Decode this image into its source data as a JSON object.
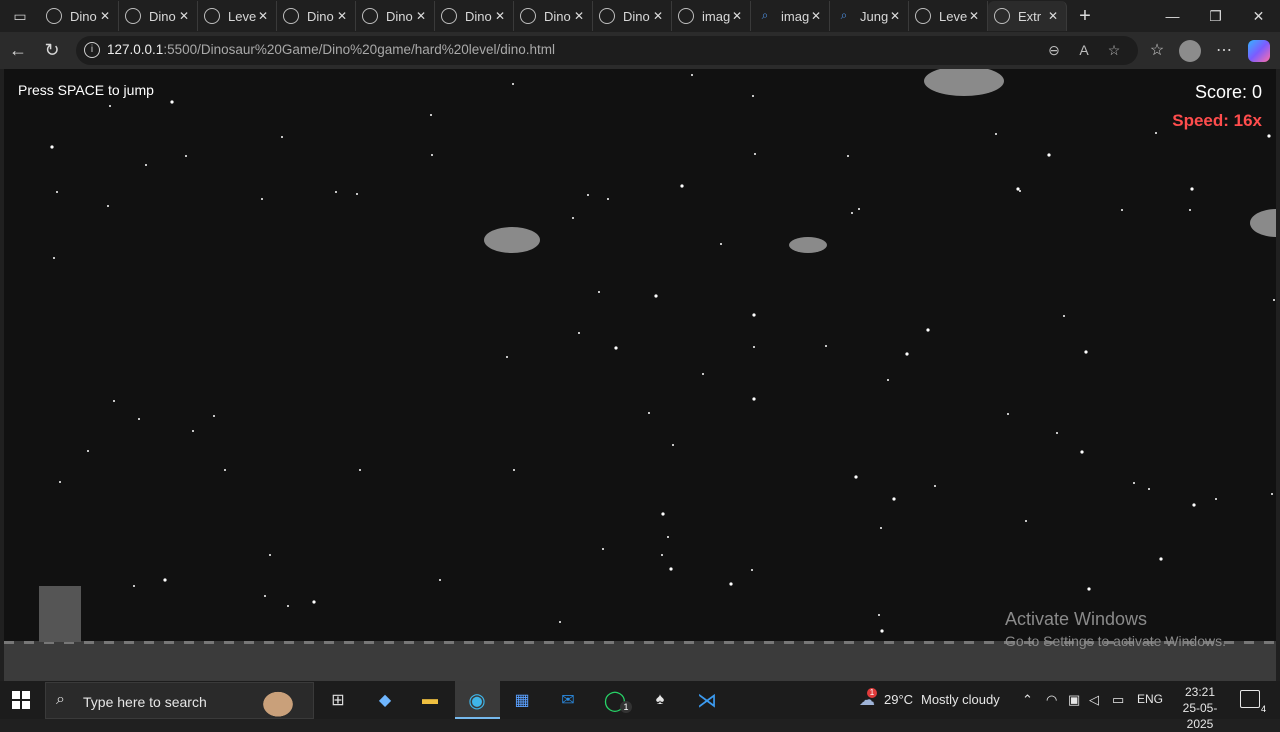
{
  "browser": {
    "tabs": [
      {
        "title": "Dino",
        "icon": "globe-icon"
      },
      {
        "title": "Dino",
        "icon": "globe-icon"
      },
      {
        "title": "Leve",
        "icon": "globe-icon"
      },
      {
        "title": "Dino",
        "icon": "globe-icon"
      },
      {
        "title": "Dino",
        "icon": "globe-icon"
      },
      {
        "title": "Dino",
        "icon": "globe-icon"
      },
      {
        "title": "Dino",
        "icon": "globe-icon"
      },
      {
        "title": "Dino",
        "icon": "globe-icon"
      },
      {
        "title": "imag",
        "icon": "image-search-icon"
      },
      {
        "title": "imag",
        "icon": "search-icon"
      },
      {
        "title": "Jung",
        "icon": "search-icon"
      },
      {
        "title": "Leve",
        "icon": "globe-icon"
      },
      {
        "title": "Extr",
        "icon": "globe-icon",
        "active": true
      }
    ],
    "url_host": "127.0.0.1",
    "url_rest": ":5500/Dinosaur%20Game/Dino%20game/hard%20level/dino.html"
  },
  "game": {
    "hint": "Press SPACE to jump",
    "score_label": "Score: 0",
    "speed_label": "Speed: 16x",
    "score": 0,
    "speed": 16,
    "background_color": "#111111",
    "speed_color": "#ff4d4d"
  },
  "watermark": {
    "line1": "Activate Windows",
    "line2": "Go to Settings to activate Windows."
  },
  "taskbar": {
    "search_placeholder": "Type here to search",
    "weather_temp": "29°C",
    "weather_text": "Mostly cloudy",
    "weather_badge": "1",
    "language": "ENG",
    "time": "23:21",
    "date": "25-05-2025",
    "whatsapp_badge": "1",
    "notifications_count": "4"
  }
}
